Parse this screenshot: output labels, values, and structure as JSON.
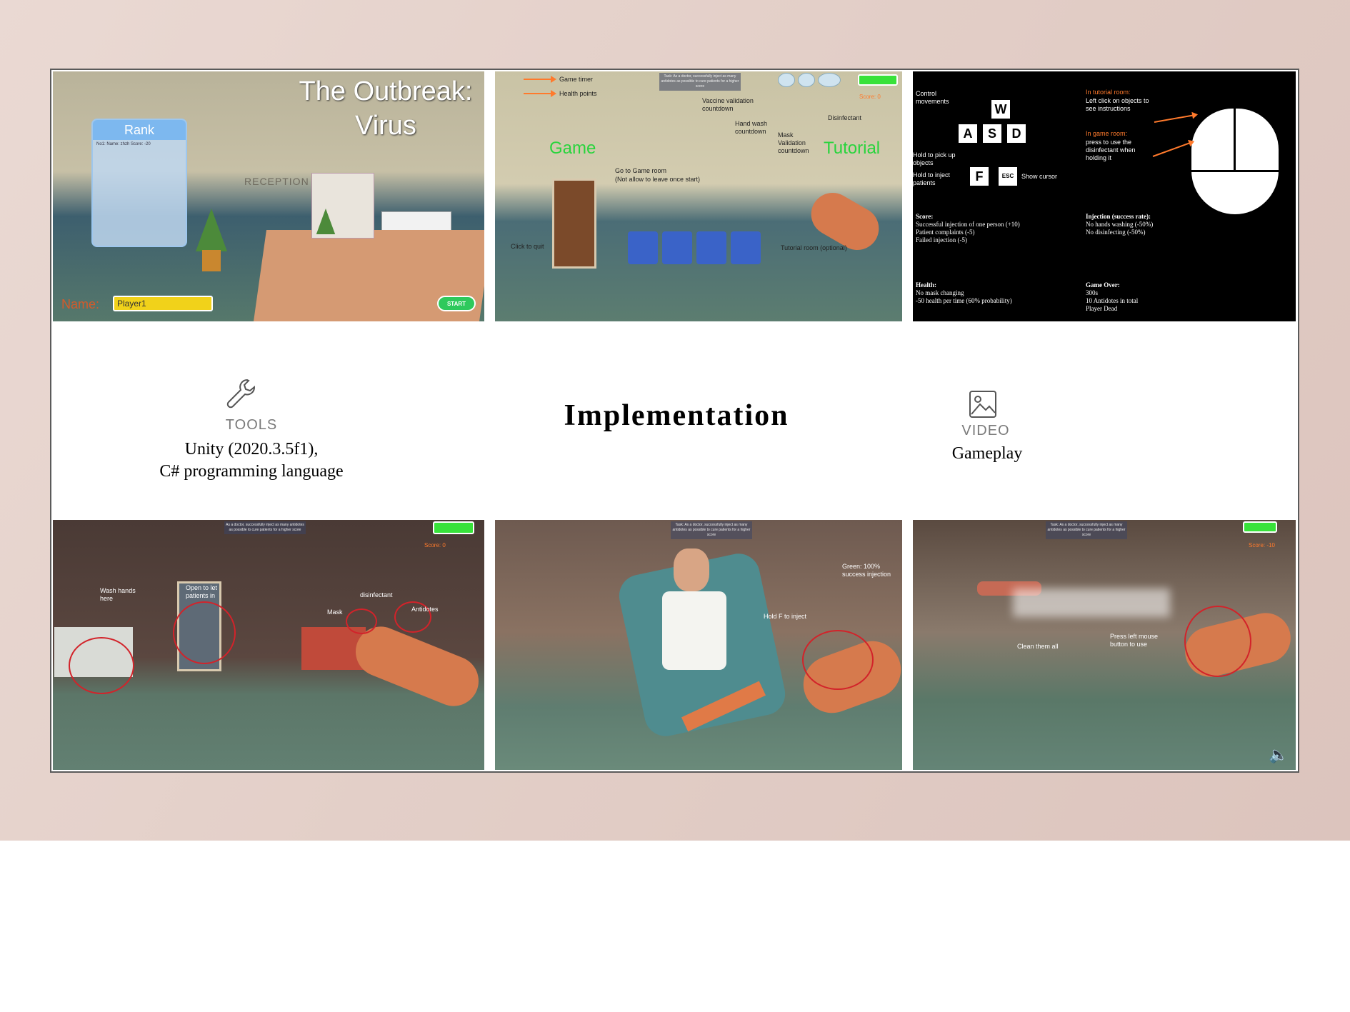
{
  "band": {
    "tools_label": "TOOLS",
    "tools_line1": "Unity (2020.3.5f1),",
    "tools_line2": "C# programming language",
    "title": "Implementation",
    "video_label": "VIDEO",
    "video_text": "Gameplay",
    "icons": {
      "tools": "wrench-icon",
      "video": "image-icon"
    }
  },
  "shot1": {
    "game_title_1": "The Outbreak:",
    "game_title_2": "Virus",
    "rank_title": "Rank",
    "rank_row": "No1:  Name: zhzh Score: -20",
    "reception": "RECEPTION",
    "name_label": "Name:",
    "name_value": "Player1",
    "start_label": "START"
  },
  "shot2": {
    "game_timer": "Game timer",
    "health_points": "Health points",
    "task": "Task: As a doctor, successfully inject as many antidotes as possible to cure patients for a higher score",
    "vaccine": "Vaccine validation countdown",
    "hand_wash": "Hand wash countdown",
    "mask": "Mask Validation countdown",
    "disinfectant": "Disinfectant",
    "game": "Game",
    "tutorial": "Tutorial",
    "go_game": "Go to Game room",
    "no_leave": "(Not allow to leave once start)",
    "click_quit": "Click to quit",
    "tutorial_room": "Tutorial room (optional)",
    "score": "Score: 0"
  },
  "shot3": {
    "control": "Control movements",
    "keys": [
      "W",
      "A",
      "S",
      "D"
    ],
    "hold_pick": "Hold to pick up objects",
    "hold_inject": "Hold to inject patients",
    "key_f": "F",
    "key_esc": "ESC",
    "show_cursor": "Show cursor",
    "tutorial_room_h": "In tutorial room:",
    "tutorial_room_t": "Left click on objects to see instructions",
    "game_room_h": "In game room:",
    "game_room_t": "press to use the disinfectant when holding it",
    "score_h": "Score:",
    "score_l1": "Successful injection of one person (+10)",
    "score_l2": "Patient complaints (-5)",
    "score_l3": "Failed injection (-5)",
    "injection_h": "Injection (success rate):",
    "injection_l1": "No hands washing (-50%)",
    "injection_l2": "No disinfecting (-50%)",
    "health_h": "Health:",
    "health_l1": "No mask changing",
    "health_l2": "-50 health per time (60% probability)",
    "gameover_h": "Game Over:",
    "gameover_l1": "300s",
    "gameover_l2": "10 Antidotes in total",
    "gameover_l3": "Player Dead"
  },
  "shot4": {
    "task": "As a doctor, successfully inject as many antidotes as possible to cure patients for a higher score",
    "wash": "Wash hands here",
    "open": "Open to let patients in",
    "mask": "Mask",
    "disinfectant": "disinfectant",
    "antidotes": "Antidotes",
    "score": "Score: 0"
  },
  "shot5": {
    "task": "Task: As a doctor, successfully inject as many antidotes as possible to cure patients for a higher score",
    "green": "Green: 100% success injection",
    "hold_f": "Hold F to inject"
  },
  "shot6": {
    "task": "Task: As a doctor, successfully inject as many antidotes as possible to cure patients for a higher score",
    "clean": "Clean them all",
    "press": "Press left mouse button to use",
    "score": "Score: -10"
  },
  "colors": {
    "accent_orange": "#ff7a2c",
    "hud_green": "#38e23a",
    "title_green": "#29d43d",
    "circle_red": "#d2232a"
  }
}
